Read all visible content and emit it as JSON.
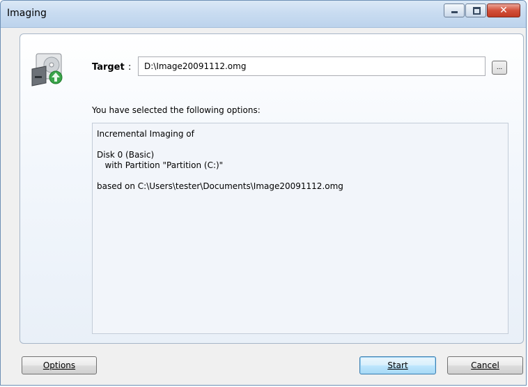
{
  "window": {
    "title": "Imaging"
  },
  "caption_buttons": {
    "close_glyph": "✕"
  },
  "target": {
    "label": "Target",
    "colon": ":",
    "value": "D:\\Image20091112.omg",
    "browse_label": "..."
  },
  "summary": {
    "heading": "You have selected the following options:",
    "lines": [
      "Incremental Imaging of",
      "",
      "Disk 0 (Basic)",
      "   with Partition \"Partition (C:)\"",
      "",
      "based on C:\\Users\\tester\\Documents\\Image20091112.omg"
    ]
  },
  "buttons": {
    "options": "Options",
    "start": "Start",
    "cancel": "Cancel"
  },
  "icons": {
    "disk": "disk-image-icon"
  },
  "colors": {
    "titlebar": "#c9dcf1",
    "panel_border": "#a7b6c8",
    "start_border": "#3c7fb1",
    "close_button": "#c23a22"
  }
}
